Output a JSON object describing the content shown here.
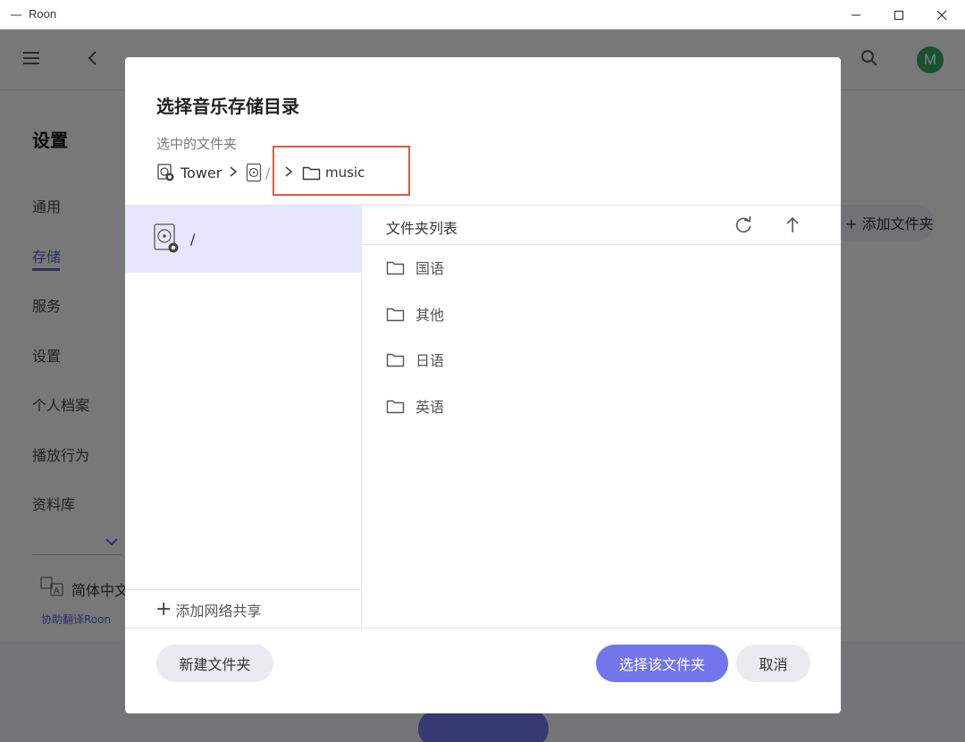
{
  "window": {
    "title": "Roon"
  },
  "app": {
    "settings_title": "设置",
    "nav": [
      "通用",
      "存储",
      "服务",
      "设置",
      "个人档案",
      "播放行为",
      "资料库"
    ],
    "active_nav": "存储",
    "language": "简体中文",
    "translate_link": "协助翻译Roon",
    "add_folder_label": "+ 添加文件夹",
    "avatar_letter": "M",
    "accent_color": "#5a5ec9"
  },
  "dialog": {
    "title": "选择音乐存储目录",
    "selected_label": "选中的文件夹",
    "breadcrumb": {
      "device": "Tower",
      "root": "/",
      "current": "music"
    },
    "locations": [
      {
        "label": "/"
      }
    ],
    "add_network_share": "添加网络共享",
    "folder_list_title": "文件夹列表",
    "folders": [
      "国语",
      "其他",
      "日语",
      "英语"
    ],
    "buttons": {
      "new_folder": "新建文件夹",
      "select_folder": "选择该文件夹",
      "cancel": "取消"
    },
    "primary_color": "#7375ec",
    "highlight_color": "#e0573f"
  }
}
